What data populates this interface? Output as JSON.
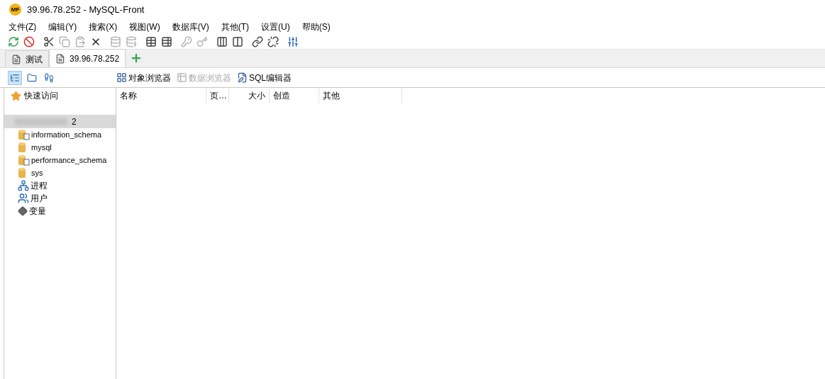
{
  "window": {
    "title": "39.96.78.252 - MySQL-Front",
    "logo": "MF"
  },
  "menu": [
    "文件(Z)",
    "编辑(Y)",
    "搜索(X)",
    "视图(W)",
    "数据库(V)",
    "其他(T)",
    "设置(U)",
    "帮助(S)"
  ],
  "toolbar": [
    {
      "kind": "refresh",
      "disabled": false
    },
    {
      "kind": "stop",
      "disabled": false
    },
    {
      "kind": "cut",
      "disabled": false
    },
    {
      "kind": "copy",
      "disabled": true
    },
    {
      "kind": "paste",
      "disabled": true
    },
    {
      "kind": "delete",
      "disabled": false
    },
    {
      "kind": "database",
      "disabled": true
    },
    {
      "kind": "database-minus",
      "disabled": true
    },
    {
      "kind": "table",
      "disabled": false
    },
    {
      "kind": "table-minus",
      "disabled": false
    },
    {
      "kind": "key",
      "disabled": true
    },
    {
      "kind": "key-minus",
      "disabled": true
    },
    {
      "kind": "columns",
      "disabled": false
    },
    {
      "kind": "columns-minus",
      "disabled": false
    },
    {
      "kind": "link",
      "disabled": false
    },
    {
      "kind": "link-minus",
      "disabled": false
    },
    {
      "kind": "sliders",
      "disabled": false
    }
  ],
  "tabs": [
    {
      "label": "测试",
      "selected": false
    },
    {
      "label": "39.96.78.252",
      "selected": true
    }
  ],
  "side_views": [
    {
      "kind": "tree",
      "selected": true
    },
    {
      "kind": "folder",
      "selected": false
    },
    {
      "kind": "history",
      "selected": false
    }
  ],
  "views": [
    {
      "kind": "objects",
      "label": "对象浏览器",
      "disabled": false
    },
    {
      "kind": "data",
      "label": "数据浏览器",
      "disabled": true
    },
    {
      "kind": "sql",
      "label": "SQL编辑器",
      "disabled": false
    }
  ],
  "quick_access": "快速访问",
  "tree": {
    "label": "2",
    "selected": true,
    "children": [
      {
        "kind": "system-database",
        "label": "information_schema"
      },
      {
        "kind": "database",
        "label": "mysql"
      },
      {
        "kind": "system-database",
        "label": "performance_schema"
      },
      {
        "kind": "database",
        "label": "sys"
      },
      {
        "kind": "processes",
        "label": "进程"
      },
      {
        "kind": "users",
        "label": "用户"
      },
      {
        "kind": "variables",
        "label": "变量"
      }
    ]
  },
  "table": {
    "columns": [
      "名称",
      "页…",
      "大小",
      "创造",
      "其他"
    ]
  }
}
